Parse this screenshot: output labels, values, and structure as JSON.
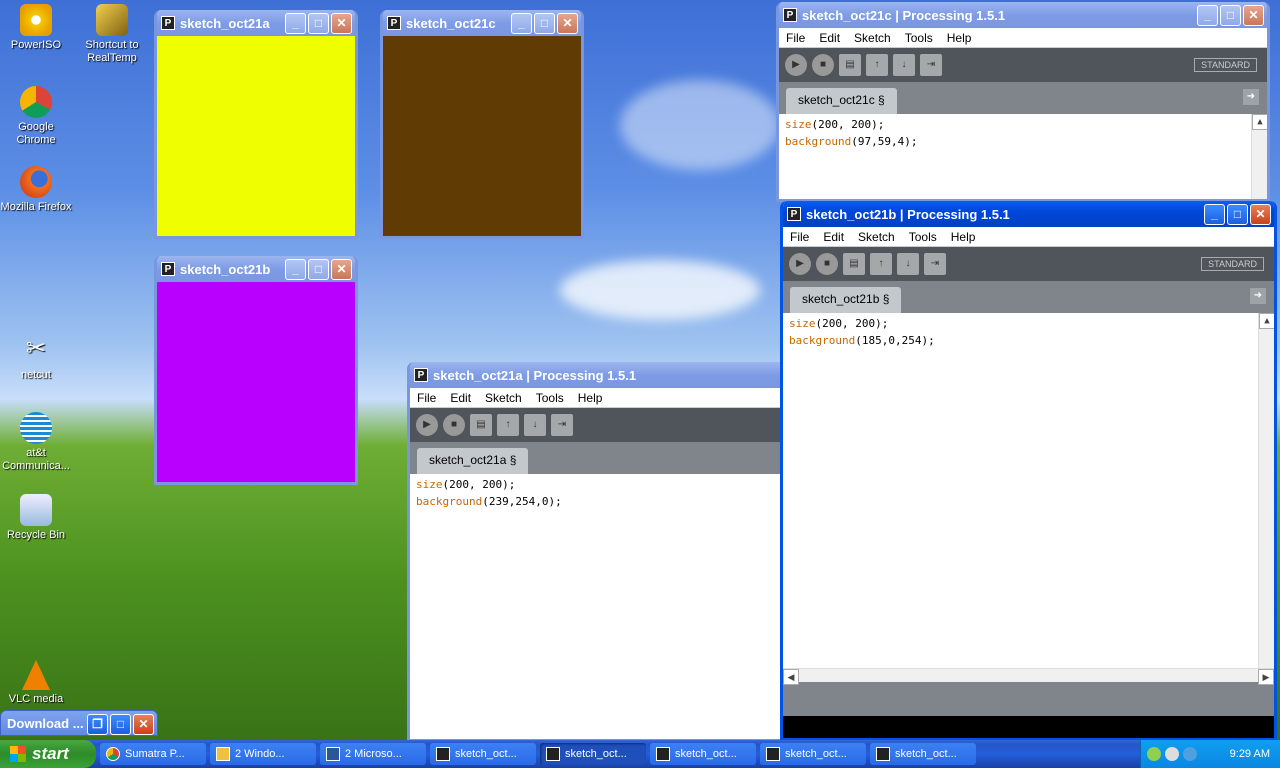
{
  "desktop": {
    "icons": [
      {
        "label": "PowerISO",
        "icon": "poweriso-icon"
      },
      {
        "label": "Shortcut to RealTemp",
        "icon": "realtemp-icon"
      },
      {
        "label": "Google Chrome",
        "icon": "chrome-icon"
      },
      {
        "label": "Mozilla Firefox",
        "icon": "firefox-icon"
      },
      {
        "label": "netcut",
        "icon": "netcut-icon"
      },
      {
        "label": "at&t Communica...",
        "icon": "att-icon"
      },
      {
        "label": "Recycle Bin",
        "icon": "recycle-bin-icon"
      },
      {
        "label": "VLC media",
        "icon": "vlc-icon"
      }
    ]
  },
  "sketch_windows": {
    "a": {
      "title": "sketch_oct21a",
      "color": "#effe00"
    },
    "c": {
      "title": "sketch_oct21c",
      "color": "#613b04"
    },
    "b": {
      "title": "sketch_oct21b",
      "color": "#b900fe"
    }
  },
  "ide": {
    "menu": [
      "File",
      "Edit",
      "Sketch",
      "Tools",
      "Help"
    ],
    "mode": "STANDARD",
    "c": {
      "title": "sketch_oct21c | Processing 1.5.1",
      "tab": "sketch_oct21c §",
      "line1_fn": "size",
      "line1_args": "(200, 200);",
      "line2_fn": "background",
      "line2_args": "(97,59,4);"
    },
    "b": {
      "title": "sketch_oct21b | Processing 1.5.1",
      "tab": "sketch_oct21b §",
      "line1_fn": "size",
      "line1_args": "(200, 200);",
      "line2_fn": "background",
      "line2_args": "(185,0,254);"
    },
    "a": {
      "title": "sketch_oct21a | Processing 1.5.1",
      "tab": "sketch_oct21a §",
      "line1_fn": "size",
      "line1_args": "(200, 200);",
      "line2_fn": "background",
      "line2_args": "(239,254,0);"
    }
  },
  "download": {
    "label": "Download ..."
  },
  "taskbar": {
    "start": "start",
    "items": [
      "Sumatra P...",
      "2 Windo...",
      "2 Microso...",
      "sketch_oct...",
      "sketch_oct...",
      "sketch_oct...",
      "sketch_oct...",
      "sketch_oct...",
      "sketch_oct..."
    ],
    "clock": "9:29 AM"
  }
}
